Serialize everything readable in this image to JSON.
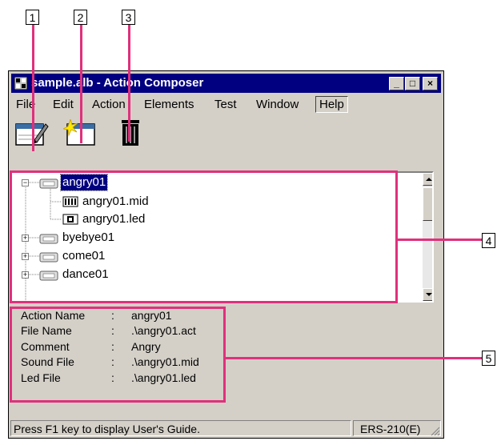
{
  "callouts": [
    "1",
    "2",
    "3",
    "4",
    "5"
  ],
  "window": {
    "title": "sample.alb - Action Composer",
    "buttons": {
      "minimize": "_",
      "maximize": "□",
      "close": "×"
    }
  },
  "menu": [
    {
      "label": "File"
    },
    {
      "label": "Edit"
    },
    {
      "label": "Action"
    },
    {
      "label": "Elements"
    },
    {
      "label": "Test"
    },
    {
      "label": "Window"
    },
    {
      "label": "Help"
    }
  ],
  "toolbar": {
    "icons": [
      "edit-action-icon",
      "new-action-icon",
      "trash-icon"
    ]
  },
  "tree": {
    "items": [
      {
        "label": "angry01",
        "expanded": true,
        "selected": true
      },
      {
        "label": "angry01.mid"
      },
      {
        "label": "angry01.led"
      },
      {
        "label": "byebye01",
        "expanded": false
      },
      {
        "label": "come01",
        "expanded": false
      },
      {
        "label": "dance01",
        "expanded": false
      }
    ],
    "expander_collapsed": "+",
    "expander_expanded": "−"
  },
  "info": {
    "rows": [
      {
        "key": "Action Name",
        "sep": ":",
        "value": "angry01"
      },
      {
        "key": "File Name",
        "sep": ":",
        "value": ".\\angry01.act"
      },
      {
        "key": "Comment",
        "sep": ":",
        "value": "Angry"
      },
      {
        "key": "Sound File",
        "sep": ":",
        "value": ".\\angry01.mid"
      },
      {
        "key": "Led File",
        "sep": ":",
        "value": ".\\angry01.led"
      }
    ]
  },
  "status": {
    "message": "Press F1 key to display User's Guide.",
    "model": "ERS-210(E)"
  },
  "colors": {
    "callout": "#e0307c",
    "titlebar": "#000080",
    "face": "#d4d0c8"
  }
}
